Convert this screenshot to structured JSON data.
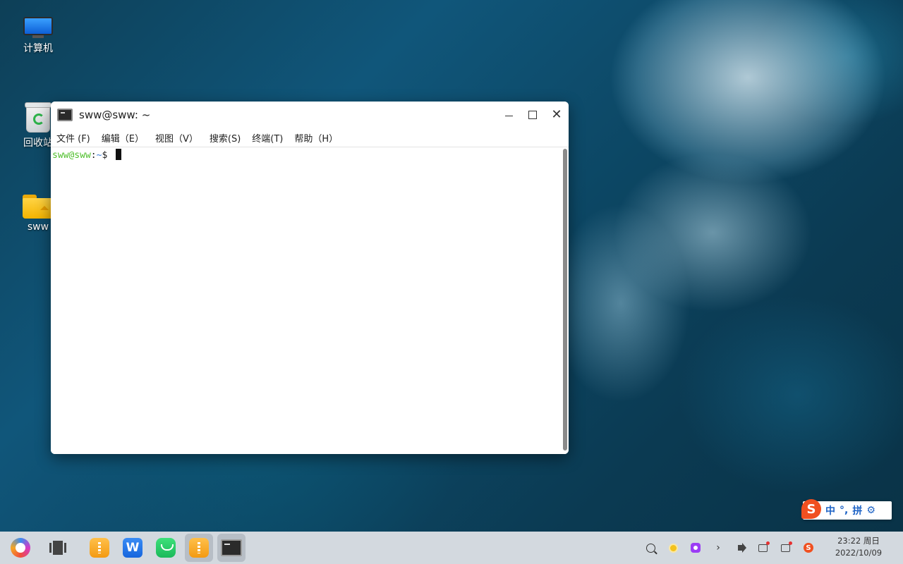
{
  "desktop": {
    "icons": [
      {
        "label": "计算机"
      },
      {
        "label": "回收站"
      },
      {
        "label": "sww"
      }
    ]
  },
  "terminal": {
    "title": "sww@sww: ~",
    "menu": [
      "文件 (F)",
      "编辑（E）",
      "视图（V）",
      "搜索(S)",
      "终端(T)",
      "帮助（H）"
    ],
    "prompt": {
      "user": "sww@sww",
      "colon": ":",
      "path": "~",
      "dollar": "$ "
    }
  },
  "ime": {
    "logo": "S",
    "mode": "中",
    "punct": "°,",
    "layout": "拼",
    "settings_icon": "gear-icon"
  },
  "taskbar": {
    "apps": [
      {
        "name": "start-menu",
        "icon": "ukui-logo-icon"
      },
      {
        "name": "multitask-view",
        "icon": "multitask-icon"
      },
      {
        "name": "archive-app",
        "icon": "archive-icon"
      },
      {
        "name": "wps",
        "icon": "wps-icon",
        "glyph": "W"
      },
      {
        "name": "green-app",
        "icon": "green-app-icon"
      },
      {
        "name": "archive-app-2",
        "icon": "archive-icon"
      },
      {
        "name": "terminal",
        "icon": "terminal-icon"
      }
    ],
    "tray": {
      "chevron": "›",
      "ime_glyph": "S"
    },
    "clock": {
      "time": "23:22 周日",
      "date": "2022/10/09"
    }
  }
}
